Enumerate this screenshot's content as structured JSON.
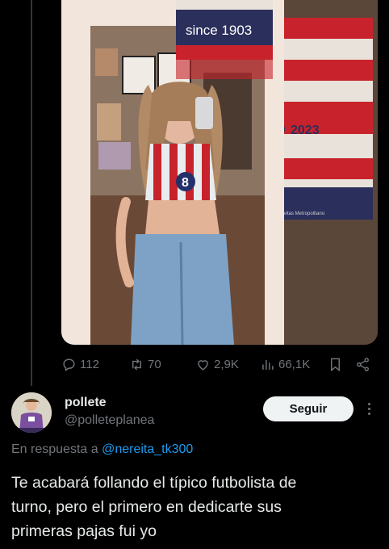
{
  "media": {
    "banner_text": "since 1903",
    "flag_text": "2023",
    "flag_small_text": "Civitas Metropolitano",
    "badge_text": "8"
  },
  "actions": {
    "replies": "112",
    "retweets": "70",
    "likes": "2,9K",
    "views": "66,1K"
  },
  "reply": {
    "display_name": "pollete",
    "handle": "@polleteplanea",
    "follow_label": "Seguir",
    "in_reply_prefix": "En respuesta a ",
    "in_reply_handle": "@nereita_tk300",
    "text": "Te acabará follando el típico futbolista de\nturno, pero el primero en dedicarte sus\nprimeras pajas fui yo"
  },
  "colors": {
    "background": "#000000",
    "text": "#e7e9ea",
    "muted": "#71767b",
    "link": "#1d9bf0",
    "follow_bg": "#eff3f4"
  }
}
